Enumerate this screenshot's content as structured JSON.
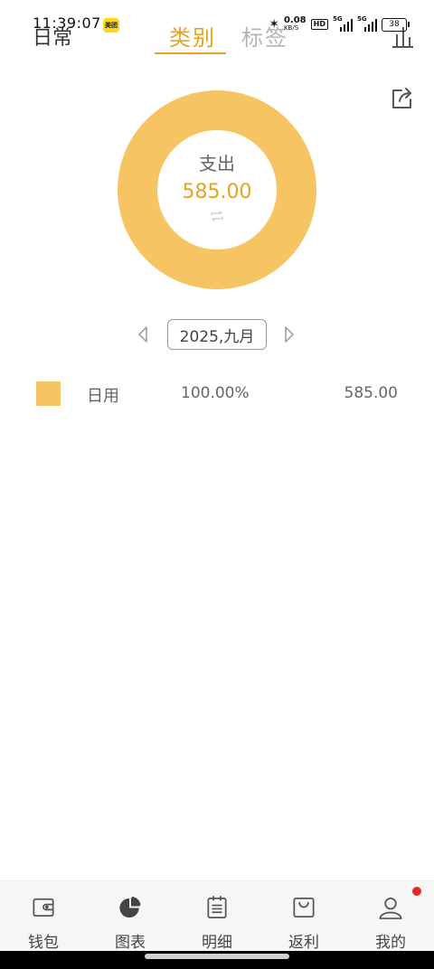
{
  "status_bar": {
    "time": "11:39:07",
    "app_badge": "美团",
    "net_speed": "0.08",
    "net_unit": "KB/S",
    "hd": "HD",
    "signal1": "5G",
    "signal2": "5G",
    "battery": "38"
  },
  "header": {
    "book_name": "日常",
    "tabs": [
      {
        "label": "类别",
        "active": true
      },
      {
        "label": "标签",
        "active": false
      }
    ],
    "accent_color": "#e8a21d"
  },
  "chart_data": {
    "type": "pie",
    "center_label": "支出",
    "center_value": "585.00",
    "slices": [
      {
        "label": "日用",
        "value": 585.0,
        "percent": 100.0,
        "color": "#f7c463"
      }
    ]
  },
  "month_selector": {
    "label": "2025,九月"
  },
  "category_list": [
    {
      "name": "日用",
      "percent": "100.00%",
      "amount": "585.00",
      "color": "#f7c463"
    }
  ],
  "bottom_nav": {
    "items": [
      {
        "label": "钱包",
        "icon": "wallet-icon"
      },
      {
        "label": "图表",
        "icon": "pie-chart-icon",
        "active": true
      },
      {
        "label": "明细",
        "icon": "clipboard-icon"
      },
      {
        "label": "返利",
        "icon": "shopping-bag-icon"
      },
      {
        "label": "我的",
        "icon": "user-icon",
        "badge": true
      }
    ]
  }
}
